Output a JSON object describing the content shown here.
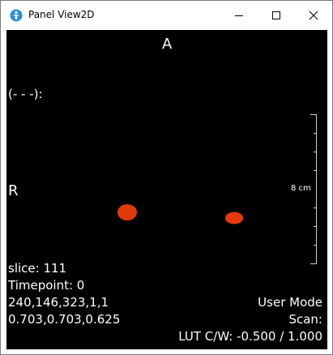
{
  "window": {
    "title": "Panel View2D",
    "controls": {
      "minimize": "minimize-icon",
      "maximize": "maximize-icon",
      "close": "close-icon"
    }
  },
  "viewer": {
    "orientation_top": "A",
    "orientation_left": "R",
    "cursor_value": "(- - -):",
    "scale_label": "8 cm",
    "info_left": {
      "slice": "slice:  111",
      "timepoint": "Timepoint: 0",
      "dims": "240,146,323,1,1",
      "spacing": "0.703,0.703,0.625"
    },
    "info_right": {
      "mode": "User Mode",
      "scan": "Scan:",
      "lut": "LUT C/W: -0.500 / 1.000"
    },
    "colors": {
      "background": "#000000",
      "overlay_text": "#ffffff",
      "lesion": "#e03a08"
    }
  }
}
